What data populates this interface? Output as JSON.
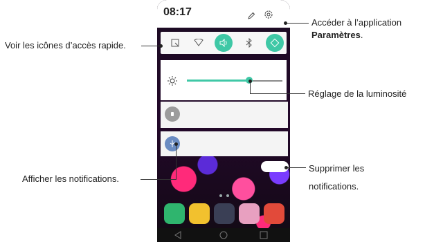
{
  "status": {
    "time": "08:17"
  },
  "callouts": {
    "quick_access": "Voir les icônes d’accès rapide.",
    "settings_line1": "Accéder à l’application",
    "settings_line2": "Paramètres",
    "settings_period": ".",
    "brightness": "Réglage de la luminosité",
    "clear_line1": "Supprimer les",
    "clear_line2": "notifications.",
    "notifications": "Afficher les notifications."
  },
  "quick_settings": [
    {
      "name": "screen-capture-icon",
      "active": false
    },
    {
      "name": "wifi-icon",
      "active": false
    },
    {
      "name": "sound-icon",
      "active": true
    },
    {
      "name": "bluetooth-icon",
      "active": false
    },
    {
      "name": "rotation-icon",
      "active": true
    }
  ],
  "brightness": {
    "level": 0.65
  },
  "colors": {
    "accent": "#3fc8a6",
    "panel": "#f4f4f4",
    "text": "#222222"
  }
}
